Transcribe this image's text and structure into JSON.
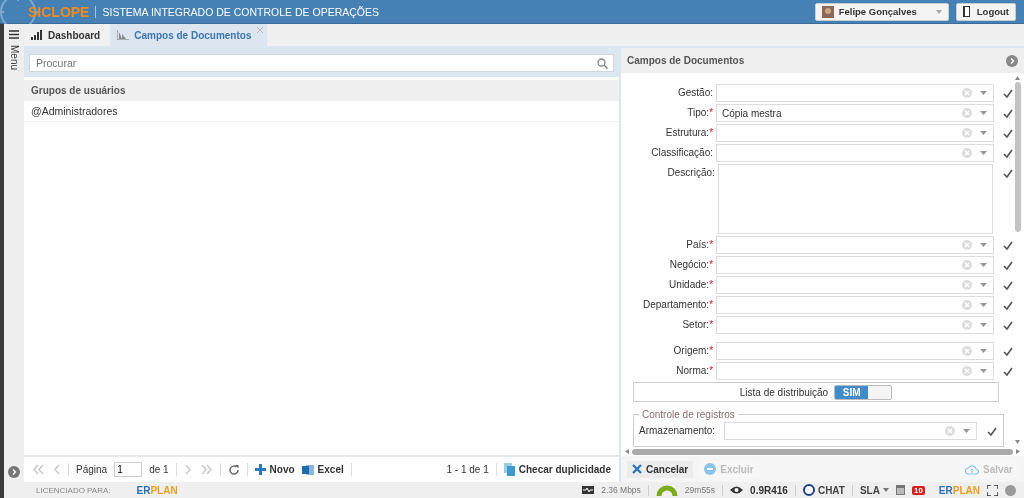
{
  "header": {
    "brand": "SICLOPE",
    "subtitle": "SISTEMA INTEGRADO DE CONTROLE DE OPERAÇÕES",
    "user": "Felipe Gonçalves",
    "logout": "Logout"
  },
  "sidebar": {
    "label": "Menu"
  },
  "tabs": [
    {
      "label": "Dashboard",
      "selected": false,
      "closable": false
    },
    {
      "label": "Campos de Documentos",
      "selected": true,
      "closable": true
    }
  ],
  "left": {
    "search": {
      "placeholder": "Procurar"
    },
    "grid": {
      "column": "Grupos de usuários",
      "rows": [
        "@Administradores"
      ]
    },
    "pager": {
      "page_label": "Página",
      "page": "1",
      "of": "de 1",
      "new": "Novo",
      "excel": "Excel",
      "range": "1 - 1 de 1",
      "dup": "Checar duplicidade"
    }
  },
  "right": {
    "title": "Campos de Documentos",
    "groups": [
      [
        {
          "kind": "select",
          "label": "Gestão:",
          "checked": true
        },
        {
          "kind": "select",
          "label": "Tipo:",
          "marker": "*",
          "value": "Cópia mestra",
          "checked": true
        },
        {
          "kind": "select",
          "label": "Estrutura:",
          "marker": "*",
          "checked": true
        },
        {
          "kind": "select",
          "label": "Classificação:",
          "checked": true
        },
        {
          "kind": "textarea",
          "label": "Descrição:",
          "checked": true
        },
        {
          "kind": "select",
          "label": "País:",
          "marker": "*",
          "checked": true
        },
        {
          "kind": "select",
          "label": "Negócio:",
          "marker": "*",
          "checked": true
        },
        {
          "kind": "select",
          "label": "Unidade:",
          "marker": "*",
          "checked": true
        },
        {
          "kind": "select",
          "label": "Departamento:",
          "marker": "*",
          "checked": true
        },
        {
          "kind": "select",
          "label": "Setor:",
          "marker": "*",
          "checked": true
        }
      ],
      [
        {
          "kind": "select",
          "label": "Origem:",
          "marker": "*",
          "checked": true
        },
        {
          "kind": "select",
          "label": "Norma:",
          "marker": "*",
          "checked": true
        }
      ]
    ],
    "distribution": {
      "label": "Lista de distribuição",
      "on": true,
      "state_label": "SIM"
    },
    "records": {
      "legend": "Controle de registros",
      "fields": [
        {
          "kind": "select",
          "label": "Armazenamento:",
          "checked": true
        }
      ]
    },
    "buttons": [
      {
        "label": "Cancelar",
        "disabled": false
      },
      {
        "label": "Excluir",
        "disabled": true
      },
      {
        "label": "Salvar",
        "disabled": true
      }
    ]
  },
  "status": {
    "licensed": "LICENCIADO PARA:",
    "logo_left": [
      "ER",
      "PLAN"
    ],
    "logo_right": [
      "ER",
      "PLAN"
    ],
    "speed": "2.36 Mbps",
    "timer": "29m55s",
    "version": "0.9R416",
    "chat": "CHAT",
    "sla": "SLA",
    "badge": "10"
  }
}
